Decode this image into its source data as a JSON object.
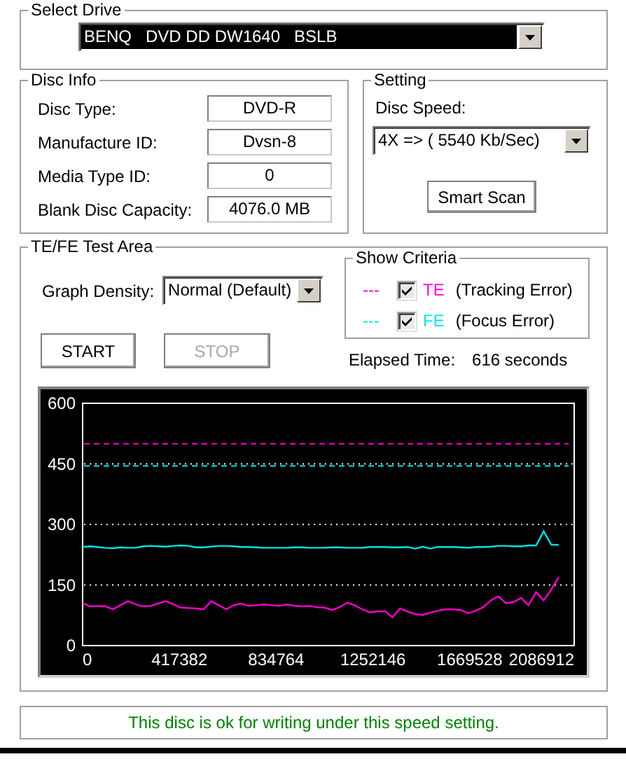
{
  "drive": {
    "title": "Select Drive",
    "value": "BENQ   DVD DD DW1640   BSLB",
    "focused": true
  },
  "disc_info": {
    "title": "Disc Info",
    "rows": [
      {
        "label": "Disc Type:",
        "value": "DVD-R"
      },
      {
        "label": "Manufacture ID:",
        "value": "Dvsn-8"
      },
      {
        "label": "Media Type ID:",
        "value": "0"
      },
      {
        "label": "Blank Disc Capacity:",
        "value": "4076.0 MB"
      }
    ]
  },
  "setting": {
    "title": "Setting",
    "speed_label": "Disc Speed:",
    "speed": {
      "value": "4X => ( 5540 Kb/Sec)",
      "focused": false
    },
    "scan_button": {
      "label": "Smart Scan",
      "disabled": false
    }
  },
  "test_area": {
    "title": "TE/FE Test Area",
    "density_label": "Graph Density:",
    "density": {
      "value": "Normal (Default)",
      "focused": false
    },
    "criteria": {
      "title": "Show Criteria",
      "items": [
        {
          "marker": "---",
          "label": "TE",
          "description": "(Tracking Error)",
          "checked": true,
          "color": "#ff00cc"
        },
        {
          "marker": "---",
          "label": "FE",
          "description": "(Focus Error)",
          "checked": true,
          "color": "#00e5e5"
        }
      ]
    },
    "buttons": [
      {
        "label": "START",
        "disabled": false
      },
      {
        "label": "STOP",
        "disabled": true
      }
    ],
    "elapsed_label": "Elapsed Time:",
    "elapsed_value": "616 seconds",
    "chart_data": {
      "type": "line",
      "x": [
        0,
        32600,
        65200,
        97800,
        130400,
        163000,
        195600,
        228200,
        260800,
        293400,
        326000,
        358600,
        391200,
        423800,
        456400,
        489000,
        521600,
        554200,
        586800,
        619400,
        652000,
        684600,
        717200,
        749800,
        782400,
        815000,
        847600,
        880200,
        912800,
        945400,
        978000,
        1010600,
        1043200,
        1075800,
        1108400,
        1141000,
        1173600,
        1206200,
        1238800,
        1271400,
        1304000,
        1336600,
        1369200,
        1401800,
        1434400,
        1467000,
        1499600,
        1532200,
        1564800,
        1597400,
        1630000,
        1662600,
        1695200,
        1727800,
        1760400,
        1793000,
        1825600,
        1858200,
        1890800,
        1923400,
        1956000,
        1988600,
        2021200,
        2053800
      ],
      "series": [
        {
          "color": "#ff00cc",
          "values": [
            105,
            97,
            98,
            97,
            90,
            100,
            110,
            102,
            97,
            98,
            104,
            110,
            102,
            94,
            93,
            92,
            90,
            110,
            100,
            90,
            100,
            104,
            98,
            100,
            102,
            100,
            98,
            102,
            99,
            97,
            98,
            95,
            94,
            88,
            95,
            106,
            100,
            90,
            82,
            85,
            85,
            70,
            92,
            84,
            78,
            76,
            82,
            86,
            90,
            90,
            88,
            80,
            86,
            95,
            112,
            122,
            105,
            108,
            118,
            100,
            132,
            112,
            138,
            170
          ]
        },
        {
          "color": "#00e5e5",
          "values": [
            244,
            246,
            244,
            242,
            241,
            243,
            242,
            242,
            246,
            247,
            246,
            245,
            247,
            248,
            247,
            243,
            243,
            245,
            247,
            247,
            246,
            244,
            244,
            243,
            242,
            242,
            242,
            242,
            243,
            243,
            242,
            242,
            242,
            243,
            243,
            242,
            242,
            242,
            244,
            244,
            244,
            243,
            243,
            244,
            240,
            245,
            240,
            244,
            244,
            244,
            243,
            242,
            244,
            244,
            245,
            247,
            247,
            246,
            246,
            248,
            248,
            283,
            250,
            249
          ]
        }
      ],
      "xlim": [
        0,
        2120000
      ],
      "ylim": [
        0,
        600
      ],
      "xticks": [
        0,
        417382,
        834764,
        1252146,
        1669528,
        2086912
      ],
      "yticks": [
        0,
        150,
        300,
        450,
        600
      ],
      "grid": true,
      "ref_lines": [
        {
          "axis": "y",
          "value": 500,
          "color": "#ff00cc"
        },
        {
          "axis": "y",
          "value": 445,
          "color": "#00e5e5"
        }
      ]
    }
  },
  "status": {
    "text": "This disc is ok for writing under this speed setting."
  }
}
